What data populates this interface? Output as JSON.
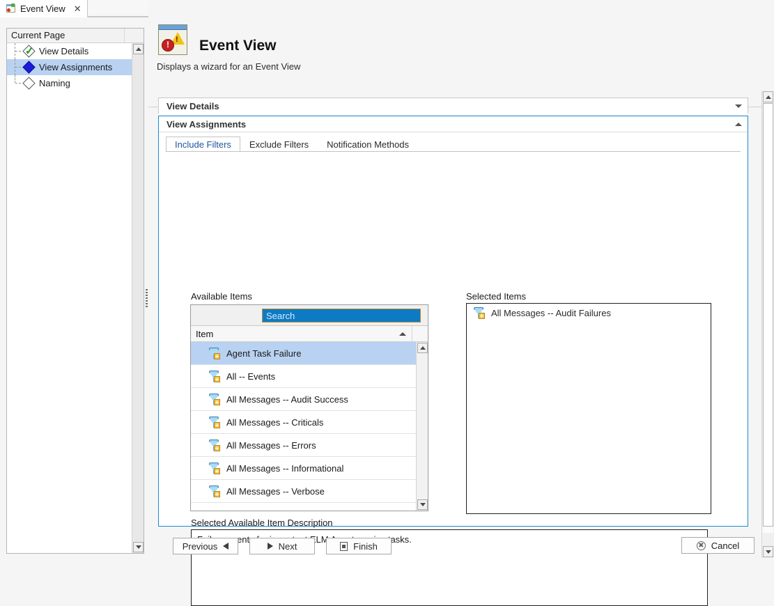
{
  "window": {
    "tab": {
      "label": "Event View",
      "icon": "event-view-icon",
      "close": "✕"
    }
  },
  "sidebar": {
    "header": "Current Page",
    "items": [
      {
        "label": "View Details",
        "state": "completed",
        "icon": "check-icon"
      },
      {
        "label": "View Assignments",
        "state": "current",
        "icon": "diamond-filled-icon"
      },
      {
        "label": "Naming",
        "state": "pending",
        "icon": "diamond-empty-icon"
      }
    ]
  },
  "wizard": {
    "title": "Event View",
    "subtitle": "Displays a wizard for an Event View",
    "icon": "event-view-large-icon"
  },
  "panels": [
    {
      "id": "view-details",
      "title": "View Details",
      "expanded": false,
      "caret": "down"
    },
    {
      "id": "view-assignments",
      "title": "View Assignments",
      "expanded": true,
      "caret": "up"
    }
  ],
  "tabs": [
    {
      "label": "Include Filters",
      "active": true
    },
    {
      "label": "Exclude Filters",
      "active": false
    },
    {
      "label": "Notification Methods",
      "active": false
    }
  ],
  "available": {
    "label": "Available Items",
    "search": {
      "value": "Search",
      "placeholder": "Search"
    },
    "column_header": "Item",
    "sort": "ascending",
    "items": [
      {
        "label": "Agent Task Failure",
        "selected": true
      },
      {
        "label": "All -- Events",
        "selected": false
      },
      {
        "label": "All Messages -- Audit Success",
        "selected": false
      },
      {
        "label": "All Messages -- Criticals",
        "selected": false
      },
      {
        "label": "All Messages -- Errors",
        "selected": false
      },
      {
        "label": "All Messages -- Informational",
        "selected": false
      },
      {
        "label": "All Messages -- Verbose",
        "selected": false
      }
    ]
  },
  "transfer": {
    "move_right": "›",
    "move_all_right": "»",
    "move_left": "‹",
    "move_all_left": "«"
  },
  "selected": {
    "label": "Selected Items",
    "items": [
      {
        "label": "All Messages -- Audit Failures"
      }
    ]
  },
  "description": {
    "label": "Selected Available Item Description",
    "text": "Failure events for important ELM Agent service tasks."
  },
  "footer": {
    "previous": "Previous",
    "next": "Next",
    "finish": "Finish",
    "cancel": "Cancel"
  },
  "colors": {
    "accent_blue": "#1d8bd1",
    "selection_blue": "#b9d2f2",
    "search_blue": "#0d7bc4",
    "tab_link": "#2155a0"
  }
}
